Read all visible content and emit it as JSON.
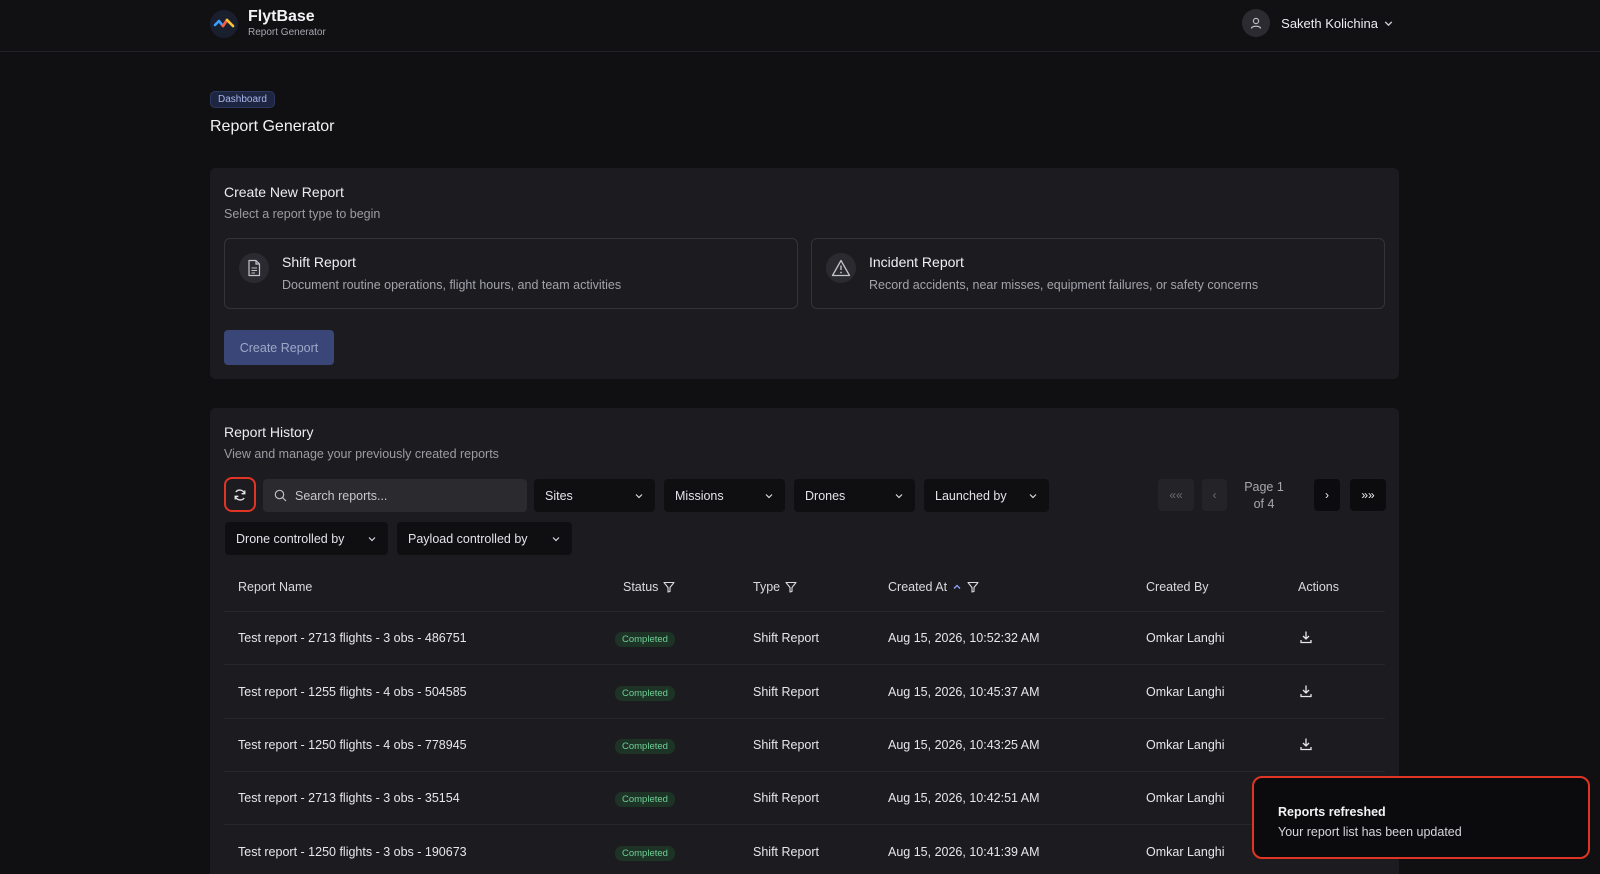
{
  "header": {
    "brand_name": "FlytBase",
    "brand_sub": "Report Generator",
    "user_name": "Saketh Kolichina"
  },
  "breadcrumb": {
    "badge": "Dashboard"
  },
  "page_title": "Report Generator",
  "create": {
    "title": "Create New Report",
    "subtitle": "Select a report type to begin",
    "types": [
      {
        "title": "Shift Report",
        "desc": "Document routine operations, flight hours, and team activities",
        "icon": "document-icon"
      },
      {
        "title": "Incident Report",
        "desc": "Record accidents, near misses, equipment failures, or safety concerns",
        "icon": "warning-triangle-icon"
      }
    ],
    "button": "Create Report"
  },
  "history": {
    "title": "Report History",
    "subtitle": "View and manage your previously created reports",
    "search_placeholder": "Search reports...",
    "filters": [
      "Sites",
      "Missions",
      "Drones",
      "Launched by",
      "Drone controlled by",
      "Payload controlled by"
    ],
    "pager": {
      "first": "««",
      "prev": "‹",
      "next": "›",
      "last": "»»",
      "page_line1": "Page 1",
      "page_line2": "of 4"
    },
    "columns": [
      "Report Name",
      "Status",
      "Type",
      "Created At",
      "Created By",
      "Actions"
    ],
    "rows": [
      {
        "name": "Test report - 2713 flights - 3 obs - 486751",
        "status": "Completed",
        "type": "Shift Report",
        "created_at": "Aug 15, 2026, 10:52:32 AM",
        "created_by": "Omkar Langhi"
      },
      {
        "name": "Test report - 1255 flights - 4 obs - 504585",
        "status": "Completed",
        "type": "Shift Report",
        "created_at": "Aug 15, 2026, 10:45:37 AM",
        "created_by": "Omkar Langhi"
      },
      {
        "name": "Test report - 1250 flights - 4 obs - 778945",
        "status": "Completed",
        "type": "Shift Report",
        "created_at": "Aug 15, 2026, 10:43:25 AM",
        "created_by": "Omkar Langhi"
      },
      {
        "name": "Test report - 2713 flights - 3 obs - 35154",
        "status": "Completed",
        "type": "Shift Report",
        "created_at": "Aug 15, 2026, 10:42:51 AM",
        "created_by": "Omkar Langhi"
      },
      {
        "name": "Test report - 1250 flights - 3 obs - 190673",
        "status": "Completed",
        "type": "Shift Report",
        "created_at": "Aug 15, 2026, 10:41:39 AM",
        "created_by": "Omkar Langhi"
      }
    ]
  },
  "toast": {
    "title": "Reports refreshed",
    "message": "Your report list has been updated"
  },
  "colors": {
    "background": "#101013",
    "card": "#1c1c20",
    "accent_button": "#3a4678",
    "status_completed": "#6fcf97",
    "highlight": "#e03424"
  }
}
